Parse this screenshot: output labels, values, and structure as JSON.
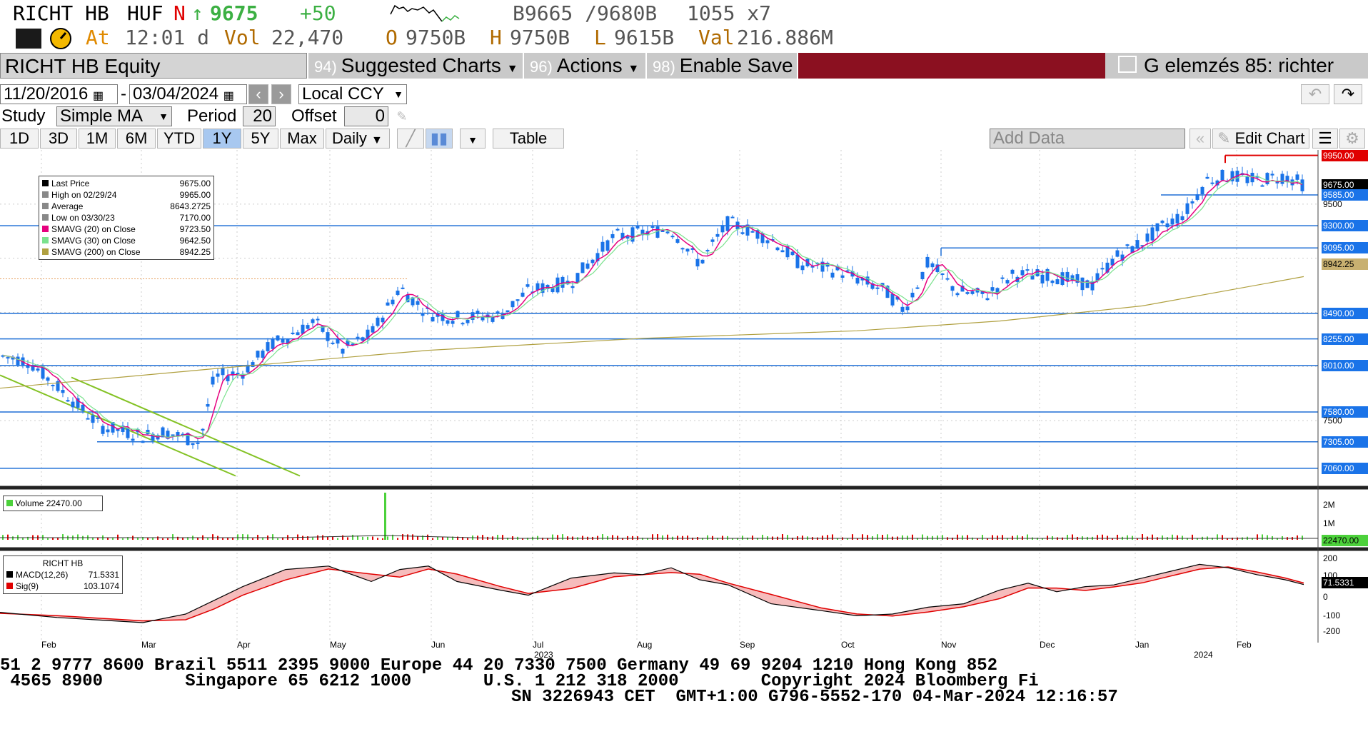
{
  "header": {
    "ticker": "RICHT HB",
    "currency": "HUF",
    "flag": "N",
    "arrow": "↑",
    "last": "9675",
    "change": "+50",
    "bid_ask": "B9665 /9680B",
    "size": "1055 x7",
    "at_label": "At",
    "time": "12:01 d",
    "vol_label": "Vol",
    "vol": "22,470",
    "open_label": "O",
    "open": "9750B",
    "high_label": "H",
    "high": "9750B",
    "low_label": "L",
    "low": "9615B",
    "val_label": "Val",
    "val": "216.886M"
  },
  "menu": {
    "security": "RICHT HB Equity",
    "suggested_num": "94)",
    "suggested": "Suggested Charts",
    "actions_num": "96)",
    "actions": "Actions",
    "save_num": "98)",
    "save": "Enable Save",
    "chart_name": "G elemzés 85: richter"
  },
  "controls": {
    "start_date": "11/20/2016",
    "end_date": "03/04/2024",
    "dash": "-",
    "ccy": "Local CCY",
    "study_label": "Study",
    "study": "Simple MA",
    "period_label": "Period",
    "period": "20",
    "offset_label": "Offset",
    "offset": "0",
    "ranges": [
      "1D",
      "3D",
      "1M",
      "6M",
      "YTD",
      "1Y",
      "5Y",
      "Max"
    ],
    "active_range": "1Y",
    "freq": "Daily",
    "table": "Table",
    "add_data": "Add Data",
    "edit_chart": "Edit Chart"
  },
  "legend": {
    "rows": [
      {
        "label": "Last Price",
        "value": "9675.00"
      },
      {
        "label": "High on 02/29/24",
        "value": "9965.00"
      },
      {
        "label": "Average",
        "value": "8643.2725"
      },
      {
        "label": "Low on 03/30/23",
        "value": "7170.00"
      },
      {
        "label": "SMAVG (20)  on Close",
        "value": "9723.50"
      },
      {
        "label": "SMAVG (30)  on Close",
        "value": "9642.50"
      },
      {
        "label": "SMAVG (200)  on Close",
        "value": "8942.25"
      }
    ],
    "volume": "Volume 22470.00",
    "macd_title": "RICHT HB",
    "macd_rows": [
      {
        "label": "MACD(12,26)",
        "value": "71.5331"
      },
      {
        "label": "Sig(9)",
        "value": "103.1074"
      }
    ]
  },
  "chart_data": {
    "type": "line",
    "title": "",
    "x_labels": [
      "Feb",
      "Mar",
      "Apr",
      "May",
      "Jun",
      "Jul",
      "Aug",
      "Sep",
      "Oct",
      "Nov",
      "Dec",
      "Jan",
      "Feb"
    ],
    "year_labels": [
      "2023",
      "2024"
    ],
    "ylim": [
      7000,
      10000
    ],
    "price_axis_labels": [
      "9950.00",
      "9675.00",
      "9585.00",
      "9300.00",
      "9095.00",
      "8942.25",
      "8490.00",
      "8255.00",
      "8010.00",
      "7580.00",
      "7305.00",
      "7060.00"
    ],
    "price_axis_ticks": [
      "9500",
      "7500"
    ],
    "volume_axis": [
      "2M",
      "1M",
      "22470.00"
    ],
    "macd_axis": [
      "200",
      "100",
      "0",
      "-100",
      "-200",
      "71.5331"
    ],
    "colors": {
      "up": "#3388ee",
      "sma20": "#e6007e",
      "sma30": "#7be28e",
      "sma200": "#b0a040",
      "hlines": "#1f6fd6",
      "trend": "#84c225",
      "red": "#e00000"
    }
  },
  "ticker_tape": {
    "line1": "51 2 9777 8600 Brazil 5511 2395 9000 Europe 44 20 7330 7500 Germany 49 69 9204 1210 Hong Kong 852",
    "line2": " 4565 8900        Singapore 65 6212 1000       U.S. 1 212 318 2000        Copyright 2024 Bloomberg Fi",
    "line3": "SN 3226943 CET  GMT+1:00 G796-5552-170 04-Mar-2024 12:16:57"
  }
}
